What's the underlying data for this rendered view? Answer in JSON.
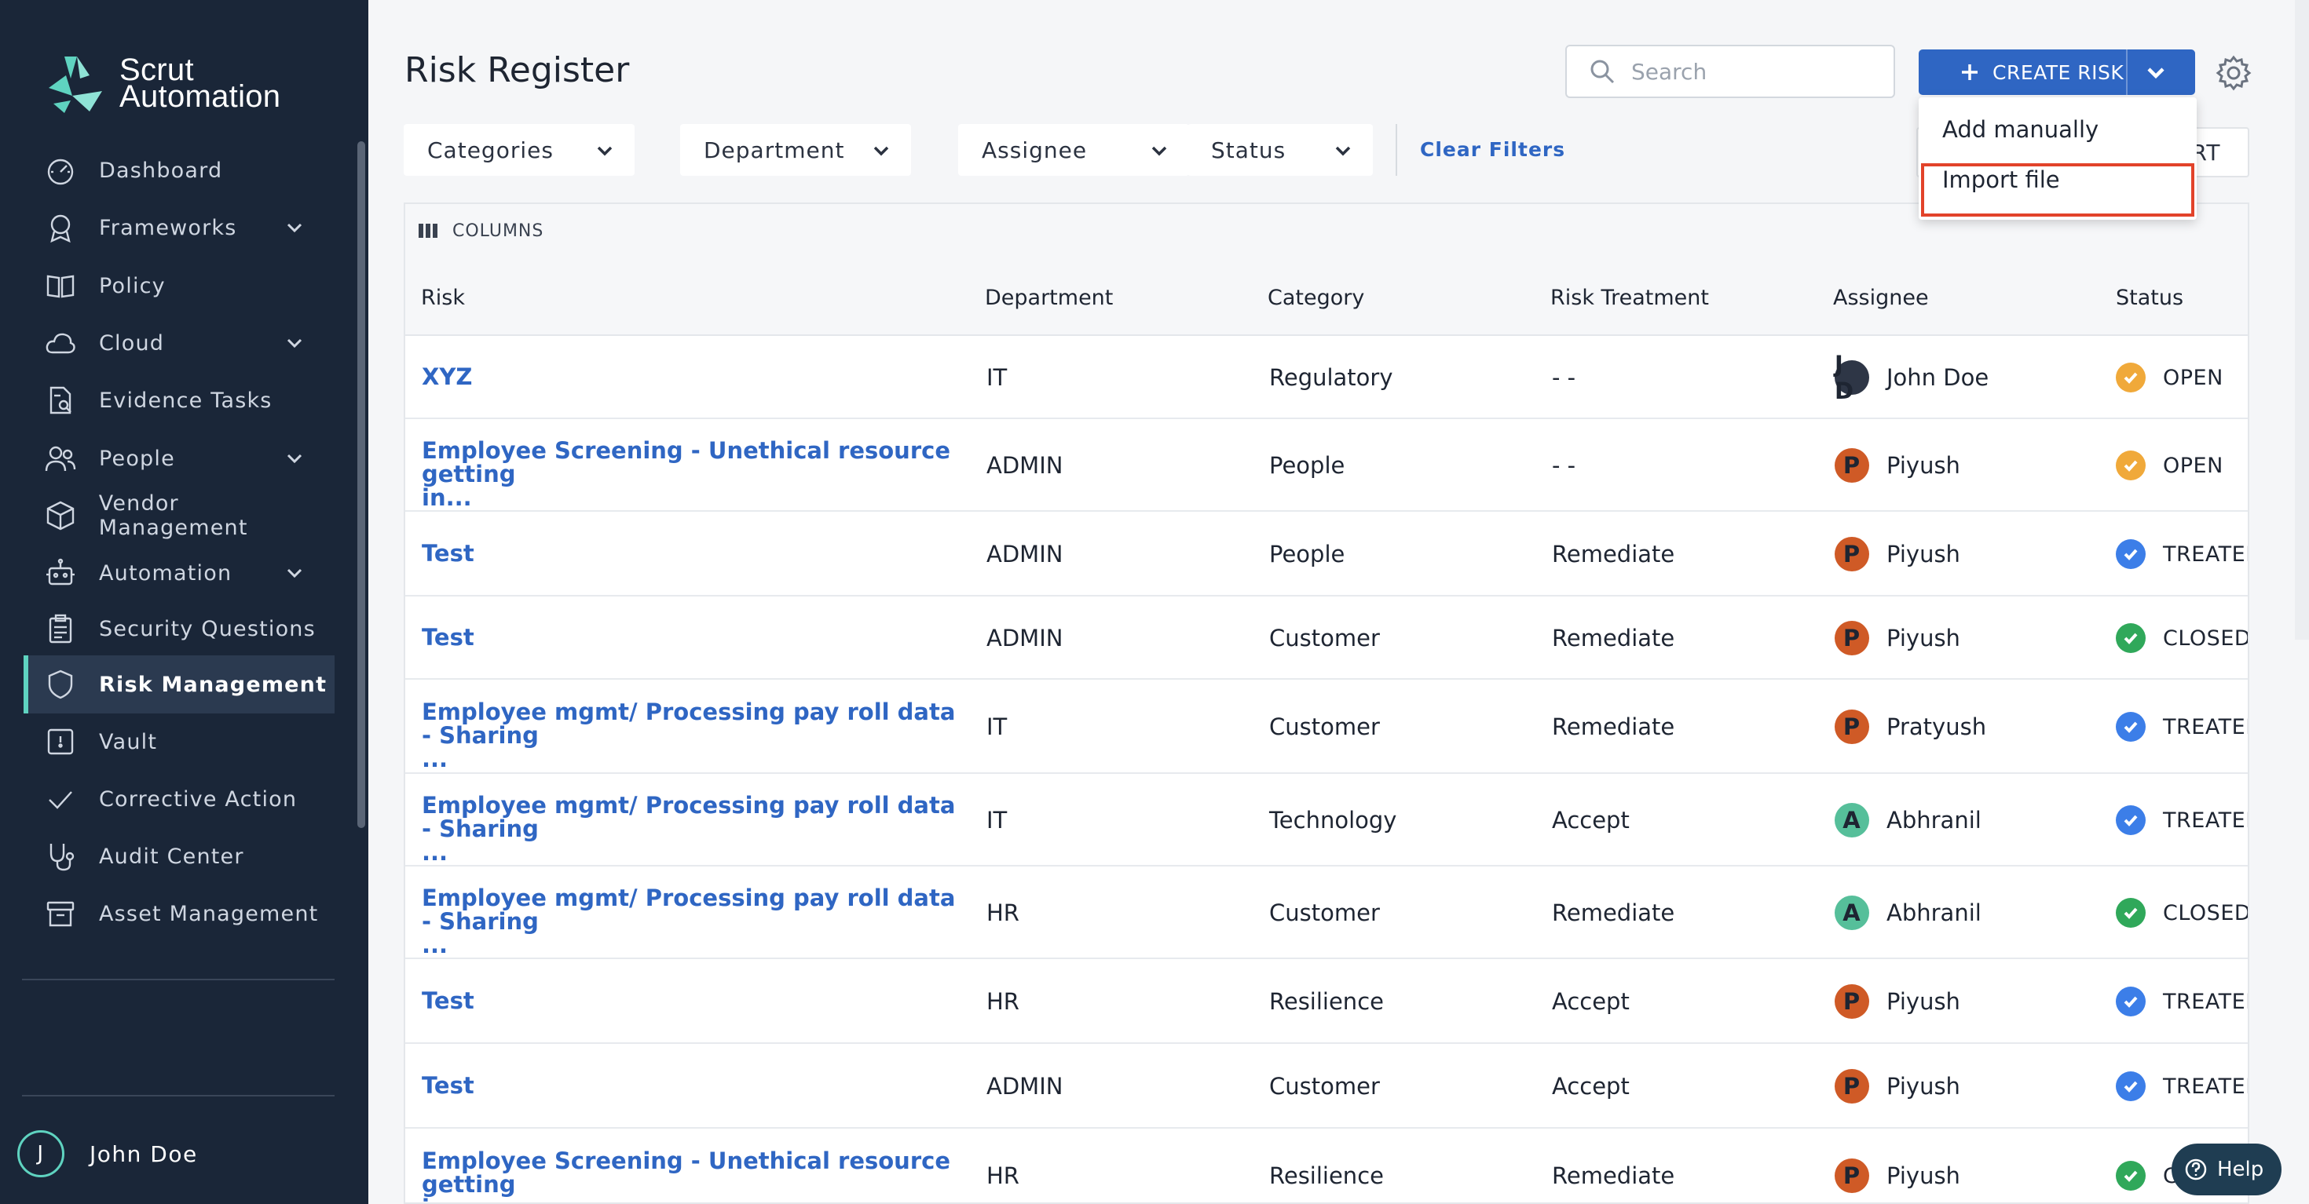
{
  "app": {
    "logo_line1": "Scrut",
    "logo_line2": "Automation",
    "brand_accent": "#5fd3c0",
    "sidebar_bg": "#1a2638",
    "primary": "#2f66c3"
  },
  "sidebar": {
    "items": [
      {
        "label": "Dashboard",
        "icon": "dashboard-icon",
        "has_chevron": false
      },
      {
        "label": "Frameworks",
        "icon": "award-icon",
        "has_chevron": true
      },
      {
        "label": "Policy",
        "icon": "book-icon",
        "has_chevron": false
      },
      {
        "label": "Cloud",
        "icon": "cloud-icon",
        "has_chevron": true
      },
      {
        "label": "Evidence Tasks",
        "icon": "document-search-icon",
        "has_chevron": false
      },
      {
        "label": "People",
        "icon": "users-icon",
        "has_chevron": true
      },
      {
        "label": "Vendor Management",
        "icon": "box-icon",
        "has_chevron": false
      },
      {
        "label": "Automation",
        "icon": "robot-icon",
        "has_chevron": true
      },
      {
        "label": "Security Questions",
        "icon": "clipboard-icon",
        "has_chevron": false
      },
      {
        "label": "Risk Management",
        "icon": "shield-icon",
        "has_chevron": false,
        "active": true
      },
      {
        "label": "Vault",
        "icon": "vault-icon",
        "has_chevron": false
      },
      {
        "label": "Corrective Action",
        "icon": "check-icon",
        "has_chevron": false
      },
      {
        "label": "Audit Center",
        "icon": "stethoscope-icon",
        "has_chevron": false
      },
      {
        "label": "Asset Management",
        "icon": "archive-icon",
        "has_chevron": false
      }
    ],
    "user": {
      "initial": "J",
      "name": "John Doe"
    }
  },
  "header": {
    "title": "Risk Register",
    "search_placeholder": "Search",
    "create_label": "CREATE RISK"
  },
  "filters": {
    "items": [
      "Categories",
      "Department",
      "Assignee",
      "Status"
    ],
    "clear_label": "Clear Filters",
    "export_visible": "RT"
  },
  "dropdown": {
    "items": [
      "Add manually",
      "Import file"
    ],
    "highlighted": "Import file"
  },
  "table": {
    "columns_label": "COLUMNS",
    "headers": [
      "Risk",
      "Department",
      "Category",
      "Risk Treatment",
      "Assignee",
      "Status"
    ],
    "rows": [
      {
        "risk_line1": "XYZ",
        "risk_line2": "",
        "department": "IT",
        "category": "Regulatory",
        "treatment": "- -",
        "assignee_initials": "J D",
        "assignee": "John Doe",
        "avatar_color": "dark",
        "status": "OPEN",
        "status_kind": "open"
      },
      {
        "risk_line1": "Employee Screening - Unethical resource getting",
        "risk_line2": "in...",
        "department": "ADMIN",
        "category": "People",
        "treatment": "- -",
        "assignee_initials": "P",
        "assignee": "Piyush",
        "avatar_color": "orange",
        "status": "OPEN",
        "status_kind": "open"
      },
      {
        "risk_line1": "Test",
        "risk_line2": "",
        "department": "ADMIN",
        "category": "People",
        "treatment": "Remediate",
        "assignee_initials": "P",
        "assignee": "Piyush",
        "avatar_color": "orange",
        "status": "TREATED",
        "status_kind": "treated"
      },
      {
        "risk_line1": "Test",
        "risk_line2": "",
        "department": "ADMIN",
        "category": "Customer",
        "treatment": "Remediate",
        "assignee_initials": "P",
        "assignee": "Piyush",
        "avatar_color": "orange",
        "status": "CLOSED",
        "status_kind": "closed"
      },
      {
        "risk_line1": "Employee mgmt/ Processing pay roll data - Sharing",
        "risk_line2": "...",
        "department": "IT",
        "category": "Customer",
        "treatment": "Remediate",
        "assignee_initials": "P",
        "assignee": "Pratyush",
        "avatar_color": "orange",
        "status": "TREATED",
        "status_kind": "treated"
      },
      {
        "risk_line1": "Employee mgmt/ Processing pay roll data - Sharing",
        "risk_line2": "...",
        "department": "IT",
        "category": "Technology",
        "treatment": "Accept",
        "assignee_initials": "A",
        "assignee": "Abhranil",
        "avatar_color": "teal",
        "status": "TREATED",
        "status_kind": "treated"
      },
      {
        "risk_line1": "Employee mgmt/ Processing pay roll data - Sharing",
        "risk_line2": "...",
        "department": "HR",
        "category": "Customer",
        "treatment": "Remediate",
        "assignee_initials": "A",
        "assignee": "Abhranil",
        "avatar_color": "teal",
        "status": "CLOSED",
        "status_kind": "closed"
      },
      {
        "risk_line1": "Test",
        "risk_line2": "",
        "department": "HR",
        "category": "Resilience",
        "treatment": "Accept",
        "assignee_initials": "P",
        "assignee": "Piyush",
        "avatar_color": "orange",
        "status": "TREATED",
        "status_kind": "treated"
      },
      {
        "risk_line1": "Test",
        "risk_line2": "",
        "department": "ADMIN",
        "category": "Customer",
        "treatment": "Accept",
        "assignee_initials": "P",
        "assignee": "Piyush",
        "avatar_color": "orange",
        "status": "TREATED",
        "status_kind": "treated"
      },
      {
        "risk_line1": "Employee Screening - Unethical resource getting",
        "risk_line2": "in...",
        "department": "HR",
        "category": "Resilience",
        "treatment": "Remediate",
        "assignee_initials": "P",
        "assignee": "Piyush",
        "avatar_color": "orange",
        "status": "C",
        "status_kind": "closed"
      }
    ]
  },
  "help": {
    "label": "Help"
  }
}
